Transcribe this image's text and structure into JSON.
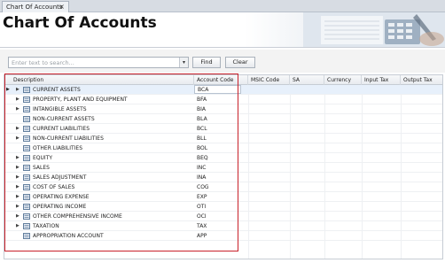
{
  "tab": {
    "label": "Chart Of Accounts",
    "close": "×"
  },
  "header": {
    "title": "Chart Of Accounts"
  },
  "search": {
    "placeholder": "Enter text to search...",
    "value": ""
  },
  "buttons": {
    "find": "Find",
    "clear": "Clear"
  },
  "grid": {
    "columns": [
      "Description",
      "Account Code",
      "MSIC Code",
      "SA",
      "Currency",
      "Input Tax",
      "Output Tax"
    ],
    "rows": [
      {
        "description": "CURRENT ASSETS",
        "code": "BCA",
        "expandable": true,
        "selected": true
      },
      {
        "description": "PROPERTY, PLANT AND EQUIPMENT",
        "code": "BFA",
        "expandable": true
      },
      {
        "description": "INTANGIBLE ASSETS",
        "code": "BIA",
        "expandable": true
      },
      {
        "description": "NON-CURRENT ASSETS",
        "code": "BLA",
        "expandable": false
      },
      {
        "description": "CURRENT LIABILITIES",
        "code": "BCL",
        "expandable": true
      },
      {
        "description": "NON-CURRENT LIABILITIES",
        "code": "BLL",
        "expandable": true
      },
      {
        "description": "OTHER LIABILITIES",
        "code": "BOL",
        "expandable": false
      },
      {
        "description": "EQUITY",
        "code": "BEQ",
        "expandable": true
      },
      {
        "description": "SALES",
        "code": "INC",
        "expandable": true
      },
      {
        "description": "SALES ADJUSTMENT",
        "code": "INA",
        "expandable": true
      },
      {
        "description": "COST OF SALES",
        "code": "COG",
        "expandable": true
      },
      {
        "description": "OPERATING EXPENSE",
        "code": "EXP",
        "expandable": true
      },
      {
        "description": "OPERATING INCOME",
        "code": "OTI",
        "expandable": true
      },
      {
        "description": "OTHER COMPREHENSIVE INCOME",
        "code": "OCI",
        "expandable": true
      },
      {
        "description": "TAXATION",
        "code": "TAX",
        "expandable": true
      },
      {
        "description": "APPROPRIATION ACCOUNT",
        "code": "APP",
        "expandable": false
      }
    ]
  },
  "icons": {
    "node": "ledger-icon",
    "expander": "expand-arrow-icon",
    "row_indicator": "current-row-icon",
    "dropdown": "chevron-down-icon"
  },
  "colors": {
    "highlight": "#c8202a",
    "selected_row": "#e7f0fb"
  }
}
